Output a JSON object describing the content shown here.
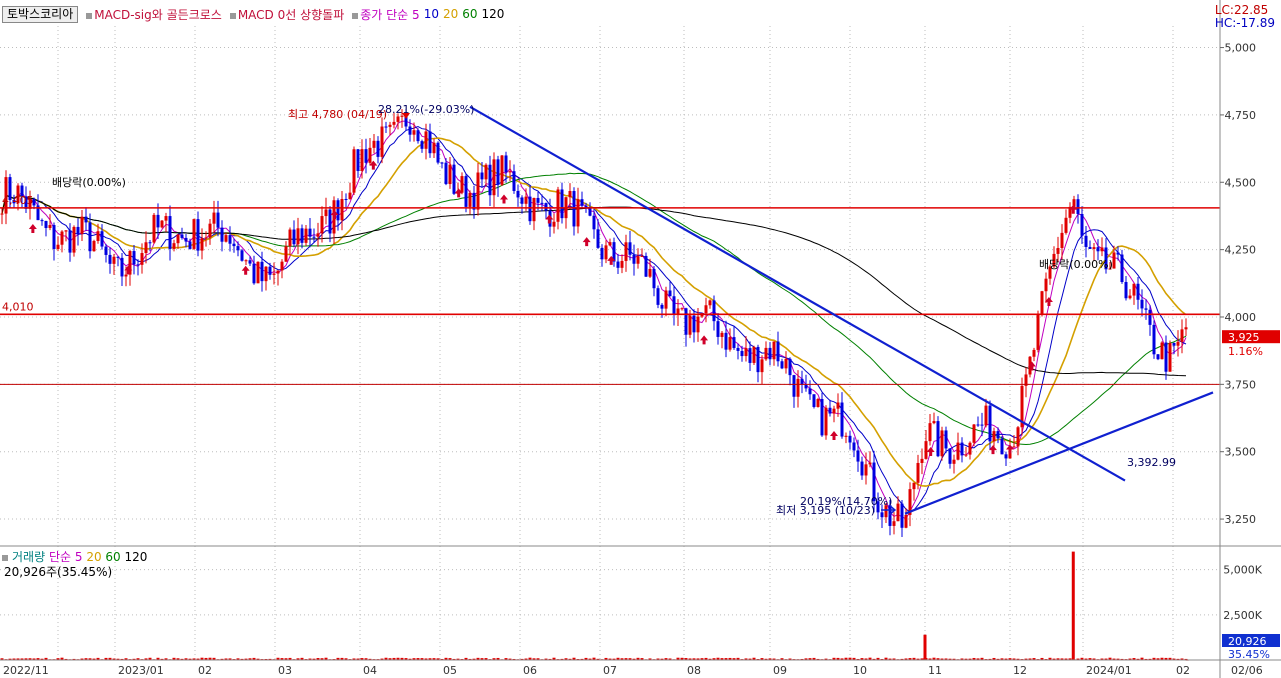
{
  "legend": {
    "box_label": "토박스코리아",
    "items": [
      {
        "label": "MACD-sig와 골든크로스",
        "color": "#c0103a"
      },
      {
        "label": "MACD 0선 상향돌파",
        "color": "#c0103a"
      },
      {
        "label": "종가 단순 5",
        "color": "#c000c0"
      },
      {
        "label": "10",
        "color": "#0000c8"
      },
      {
        "label": "20",
        "color": "#d4a000"
      },
      {
        "label": "60",
        "color": "#008000"
      },
      {
        "label": "120",
        "color": "#000000"
      }
    ]
  },
  "lc_label": "LC:22.85",
  "hc_label": "HC:-17.89",
  "price_axis": {
    "ticks": [
      "5,000",
      "4,750",
      "4,500",
      "4,250",
      "4,000",
      "3,750",
      "3,500",
      "3,250"
    ],
    "tick_values": [
      5000,
      4750,
      4500,
      4250,
      4000,
      3750,
      3500,
      3250
    ]
  },
  "current_price": {
    "value": "3,925",
    "change": "1.16%",
    "price": 3925
  },
  "hlines": [
    {
      "label": "4,010",
      "price": 4010
    },
    {
      "label": "4,405",
      "price": 4405
    },
    {
      "label": "",
      "price": 3750
    }
  ],
  "annotations": {
    "high_label": "최고 4,780 (04/19)",
    "high_pct": "28.21%(-29.03%)",
    "low_label": "최저 3,195 (10/23)",
    "low_pct": "20.19%(14.70%)",
    "dividend1": "배당락(0.00%)",
    "dividend2": "배당락(0.00%)",
    "trend_end": "3,392.99"
  },
  "x_axis": {
    "labels": [
      "2022/11",
      "2023/01",
      "02",
      "03",
      "04",
      "05",
      "06",
      "07",
      "08",
      "09",
      "10",
      "11",
      "12",
      "2024/01",
      "02",
      "02/06"
    ]
  },
  "volume": {
    "legend_title": "거래량",
    "legend_items": [
      {
        "label": "단순 5",
        "color": "#c000c0"
      },
      {
        "label": "20",
        "color": "#d4a000"
      },
      {
        "label": "60",
        "color": "#008000"
      },
      {
        "label": "120",
        "color": "#000000"
      }
    ],
    "summary": "20,926주(35.45%)",
    "axis_ticks": [
      "5,000K",
      "2,500K"
    ],
    "current_value": "20,926",
    "current_pct": "35.45%"
  },
  "chart_data": {
    "type": "candlestick",
    "title": "",
    "period": "2022/11 - 2024/02/06",
    "ylim": [
      3150,
      5080
    ],
    "key_points": [
      {
        "date": "2022/11",
        "close": 4450
      },
      {
        "date": "2023/01",
        "close": 4200
      },
      {
        "date": "2023/02",
        "close": 4350
      },
      {
        "date": "2023/03",
        "close": 4150
      },
      {
        "date": "2023/04",
        "close": 4550
      },
      {
        "date": "2023/04/19",
        "close": 4780
      },
      {
        "date": "2023/05",
        "close": 4520
      },
      {
        "date": "2023/06",
        "close": 4480
      },
      {
        "date": "2023/07",
        "close": 4300
      },
      {
        "date": "2023/08",
        "close": 4000
      },
      {
        "date": "2023/09",
        "close": 3850
      },
      {
        "date": "2023/10",
        "close": 3550
      },
      {
        "date": "2023/10/23",
        "close": 3195
      },
      {
        "date": "2023/11",
        "close": 3550
      },
      {
        "date": "2023/12",
        "close": 3560
      },
      {
        "date": "2023/12/27",
        "close": 4450
      },
      {
        "date": "2024/01",
        "close": 4300
      },
      {
        "date": "2024/02",
        "close": 3850
      },
      {
        "date": "2024/02/06",
        "close": 3925
      }
    ],
    "trendlines": [
      {
        "name": "",
        "start": {
          "date": "2023/05",
          "price": 4780
        },
        "end": {
          "date": "2024/02",
          "price": 3392.99
        }
      },
      {
        "name": "",
        "start": {
          "date": "2023/10/23",
          "price": 3270
        },
        "end": {
          "date": "2024/02/06",
          "price": 3720
        }
      }
    ],
    "volume_spikes": [
      {
        "date": "2023/10/31",
        "volume": 1400000
      },
      {
        "date": "2023/12/27",
        "volume": 6000000
      },
      {
        "date": "2024/02/06",
        "volume": 20926
      }
    ]
  }
}
